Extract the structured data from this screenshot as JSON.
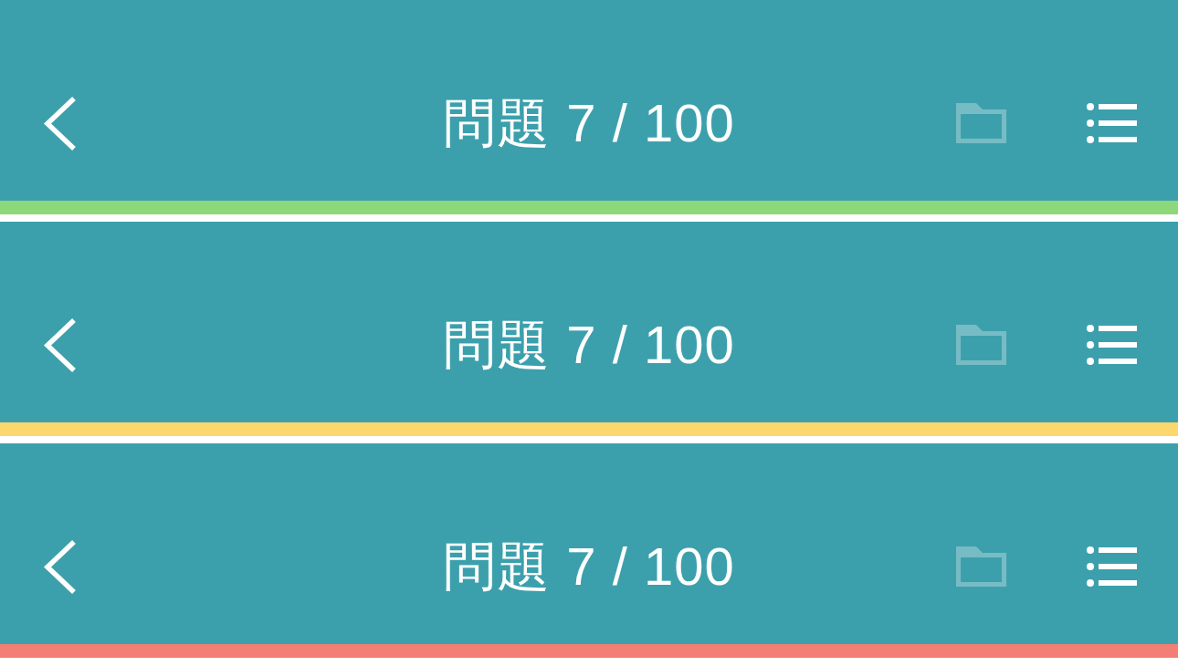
{
  "bars": [
    {
      "title": "問題 7 / 100",
      "folder_button": {
        "disabled": true
      },
      "color": "#8cd87a"
    },
    {
      "title": "問題 7 / 100",
      "folder_button": {
        "disabled": true
      },
      "color": "#fcd76e"
    },
    {
      "title": "問題 7 / 100",
      "folder_button": {
        "disabled": true
      },
      "color": "#f27e76"
    }
  ]
}
